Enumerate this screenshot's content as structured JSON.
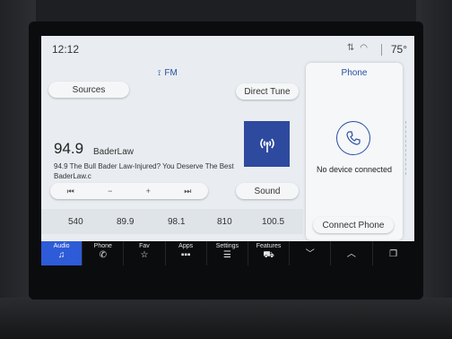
{
  "status": {
    "time": "12:12",
    "temperature": "75°"
  },
  "audio": {
    "source": "FM",
    "sources_label": "Sources",
    "direct_tune_label": "Direct Tune",
    "frequency": "94.9",
    "station_name": "BaderLaw",
    "radio_text": "94.9 The Bull Bader Law-Injured? You Deserve The Best BaderLaw.c",
    "sound_label": "Sound",
    "controls": {
      "seek_back": "⏮",
      "minus": "−",
      "plus": "+",
      "seek_forward": "⏭"
    },
    "presets": [
      "540",
      "89.9",
      "98.1",
      "810",
      "100.5"
    ]
  },
  "phone": {
    "title": "Phone",
    "status": "No device connected",
    "connect_label": "Connect Phone"
  },
  "nav": {
    "audio": "Audio",
    "phone": "Phone",
    "fav": "Fav",
    "apps": "Apps",
    "settings": "Settings",
    "features": "Features"
  },
  "colors": {
    "accent": "#2b4fa0",
    "active_tab": "#2e5bd8",
    "album_art": "#2e4a9e"
  },
  "icons": [
    "wifi-icon",
    "radio-antenna-icon",
    "music-note-icon",
    "phone-icon",
    "star-icon",
    "apps-grid-icon",
    "settings-sliders-icon",
    "car-icon",
    "chevron-down-icon",
    "chevron-up-icon",
    "copy-icon"
  ]
}
